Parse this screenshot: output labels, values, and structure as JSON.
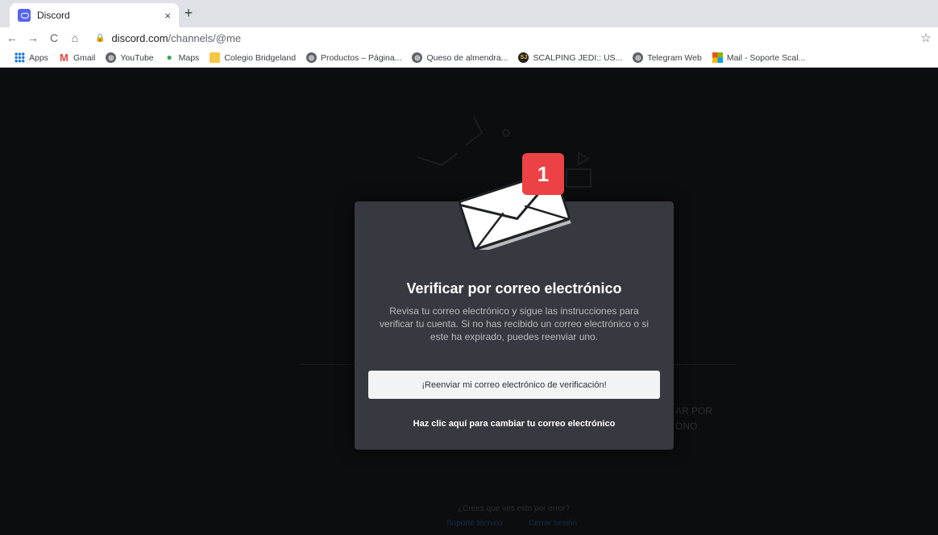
{
  "browser": {
    "tab_title": "Discord",
    "tab_close": "×",
    "new_tab": "+",
    "url_host": "discord.com",
    "url_path": "/channels/@me",
    "nav": {
      "back": "←",
      "forward": "→",
      "reload": "C",
      "home": "⌂"
    },
    "lock": "🔒",
    "star": "☆"
  },
  "bookmarks": [
    {
      "label": "Apps",
      "icon": "apps-grid-icon"
    },
    {
      "label": "Gmail",
      "icon": "gmail-icon"
    },
    {
      "label": "YouTube",
      "icon": "globe-icon"
    },
    {
      "label": "Maps",
      "icon": "maps-pin-icon"
    },
    {
      "label": "Colegio Bridgeland",
      "icon": "folder-icon"
    },
    {
      "label": "Productos – Página...",
      "icon": "globe-icon"
    },
    {
      "label": "Queso de almendra...",
      "icon": "globe-icon"
    },
    {
      "label": "SCALPING JEDI:: US...",
      "icon": "sj-logo-icon"
    },
    {
      "label": "Telegram Web",
      "icon": "globe-icon"
    },
    {
      "label": "Mail - Soporte Scal...",
      "icon": "microsoft-icon"
    }
  ],
  "modal": {
    "badge_count": "1",
    "title": "Verificar por correo electrónico",
    "description": "Revisa tu correo electrónico y sigue las instrucciones para verificar tu cuenta. Si no has recibido un correo electrónico o si este ha expirado, puedes reenviar uno.",
    "resend_button": "¡Reenviar mi correo electrónico de verificación!",
    "change_email_link": "Haz clic aquí para cambiar tu correo electrónico"
  },
  "background": {
    "ghost_right_1": "AR POR",
    "ghost_right_2": "ONO",
    "ghost_question": "¿Crees que ves esto por error?",
    "ghost_support": "Soporte técnico",
    "ghost_logout": "Cerrar sesión"
  },
  "colors": {
    "discord_blurple": "#5865f2",
    "badge_red": "#ed4245",
    "modal_bg": "#36393f"
  }
}
